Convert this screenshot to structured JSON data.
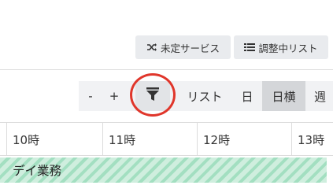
{
  "top_buttons": {
    "unassigned": {
      "label": "未定サービス",
      "icon": "shuffle-icon"
    },
    "adjusting": {
      "label": "調整中リスト",
      "icon": "list-icon"
    }
  },
  "toolbar": {
    "minus_label": "-",
    "plus_label": "+",
    "filter_icon": "filter-icon",
    "list_label": "リスト",
    "day_label": "日",
    "day_horizontal_label": "日横",
    "week_label": "週",
    "active_view": "日横"
  },
  "timeline": {
    "hours": [
      "10時",
      "11時",
      "12時",
      "13時"
    ]
  },
  "rows": [
    {
      "label": "デイ業務"
    }
  ],
  "colors": {
    "highlight": "#e0362b",
    "band_light": "#cfeede",
    "band_dark": "#a3dfc1",
    "button_bg": "#e9ebee"
  }
}
